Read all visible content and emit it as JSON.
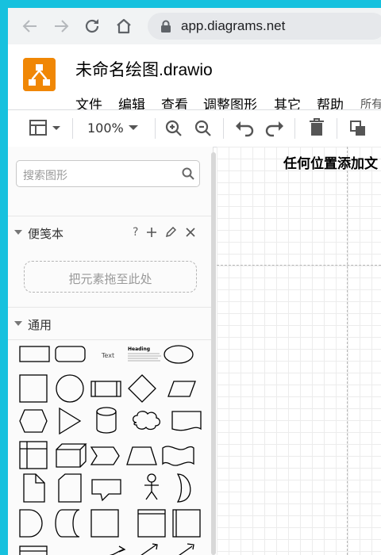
{
  "browser": {
    "url": "app.diagrams.net"
  },
  "app": {
    "title": "未命名绘图.drawio",
    "menus": [
      "文件",
      "编辑",
      "查看",
      "调整图形",
      "其它",
      "帮助",
      "所有"
    ]
  },
  "toolbar": {
    "zoom": "100%"
  },
  "sidebar": {
    "search_placeholder": "搜索图形",
    "scratchpad": {
      "title": "便笺本",
      "help": "?",
      "drop_hint": "把元素拖至此处"
    },
    "general": {
      "title": "通用",
      "text_shape_label": "Text",
      "heading_shape_label": "Heading"
    }
  },
  "canvas": {
    "hint": "任何位置添加文"
  },
  "colors": {
    "frame": "#16c1de",
    "logo": "#f08705"
  }
}
